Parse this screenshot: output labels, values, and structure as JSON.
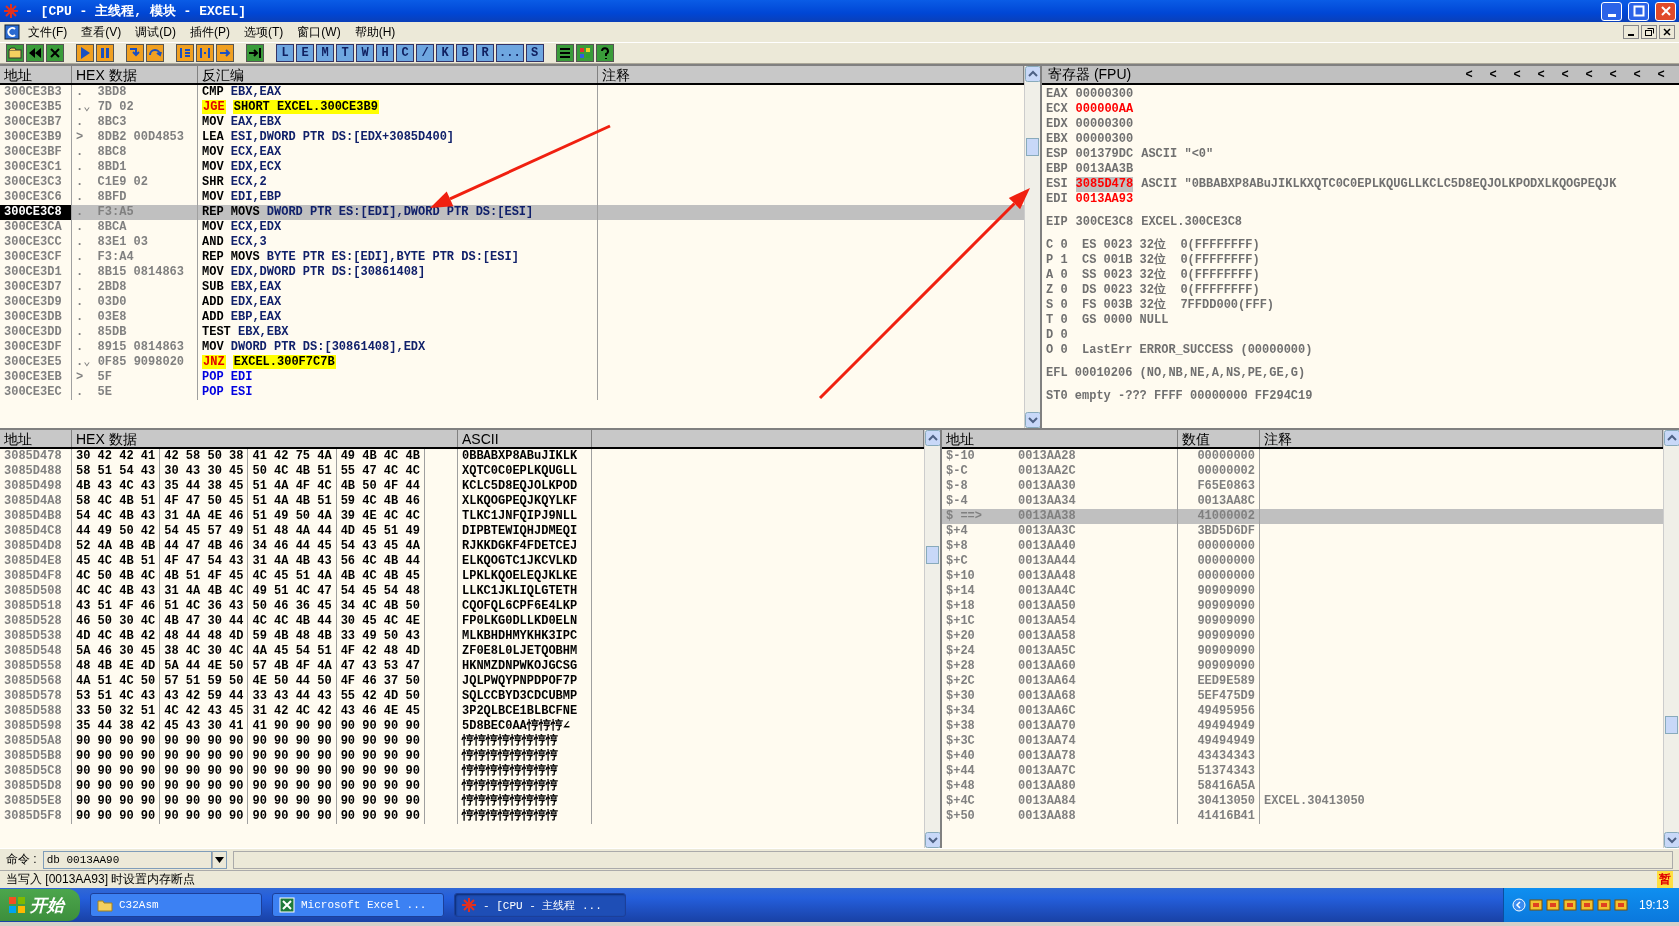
{
  "window": {
    "title": "- [CPU - 主线程, 模块 - EXCEL]"
  },
  "menu": {
    "items": [
      "文件(F)",
      "查看(V)",
      "调试(D)",
      "插件(P)",
      "选项(T)",
      "窗口(W)",
      "帮助(H)"
    ]
  },
  "toolbar": {
    "items": [
      {
        "kind": "icon"
      },
      {
        "kind": "icon"
      },
      {
        "kind": "icon"
      },
      {
        "kind": "sep"
      },
      {
        "kind": "icon"
      },
      {
        "kind": "icon"
      },
      {
        "kind": "sep"
      },
      {
        "kind": "icon"
      },
      {
        "kind": "icon"
      },
      {
        "kind": "sep"
      },
      {
        "kind": "icon"
      },
      {
        "kind": "icon"
      },
      {
        "kind": "icon"
      },
      {
        "kind": "sep"
      },
      {
        "kind": "icon"
      },
      {
        "kind": "sep"
      },
      {
        "kind": "letter",
        "label": "L"
      },
      {
        "kind": "letter",
        "label": "E"
      },
      {
        "kind": "letter",
        "label": "M"
      },
      {
        "kind": "letter",
        "label": "T"
      },
      {
        "kind": "letter",
        "label": "W"
      },
      {
        "kind": "letter",
        "label": "H"
      },
      {
        "kind": "letter",
        "label": "C"
      },
      {
        "kind": "letter",
        "label": "/"
      },
      {
        "kind": "letter",
        "label": "K"
      },
      {
        "kind": "letter",
        "label": "B"
      },
      {
        "kind": "letter",
        "label": "R"
      },
      {
        "kind": "letter",
        "label": "..."
      },
      {
        "kind": "letter",
        "label": "S"
      },
      {
        "kind": "sep"
      },
      {
        "kind": "icon"
      },
      {
        "kind": "icon"
      },
      {
        "kind": "icon"
      }
    ]
  },
  "disassembly": {
    "columns": [
      "地址",
      "HEX 数据",
      "反汇编",
      "注释"
    ],
    "rows": [
      {
        "address": "300CE3B3",
        "mark": ".",
        "hex": "3BD8",
        "kind": "plain",
        "mnemonic": "CMP",
        "operands": "EBX,EAX",
        "selected": false
      },
      {
        "address": "300CE3B5",
        "mark": ".⌄",
        "hex": "7D 02",
        "kind": "jump",
        "mnemonic": "JGE",
        "operands": "SHORT EXCEL.300CE3B9",
        "selected": false
      },
      {
        "address": "300CE3B7",
        "mark": ".",
        "hex": "8BC3",
        "kind": "plain",
        "mnemonic": "MOV",
        "operands": "EAX,EBX",
        "selected": false
      },
      {
        "address": "300CE3B9",
        "mark": ">",
        "hex": "8DB2 00D4853",
        "kind": "plain",
        "mnemonic": "LEA",
        "operands": "ESI,DWORD PTR DS:[EDX+3085D400]",
        "selected": false
      },
      {
        "address": "300CE3BF",
        "mark": ".",
        "hex": "8BC8",
        "kind": "plain",
        "mnemonic": "MOV",
        "operands": "ECX,EAX",
        "selected": false
      },
      {
        "address": "300CE3C1",
        "mark": ".",
        "hex": "8BD1",
        "kind": "plain",
        "mnemonic": "MOV",
        "operands": "EDX,ECX",
        "selected": false
      },
      {
        "address": "300CE3C3",
        "mark": ".",
        "hex": "C1E9 02",
        "kind": "plain",
        "mnemonic": "SHR",
        "operands": "ECX,2",
        "selected": false
      },
      {
        "address": "300CE3C6",
        "mark": ".",
        "hex": "8BFD",
        "kind": "plain",
        "mnemonic": "MOV",
        "operands": "EDI,EBP",
        "selected": false
      },
      {
        "address": "300CE3C8",
        "mark": ".",
        "hex": "F3:A5",
        "kind": "plain",
        "mnemonic": "REP MOVS",
        "operands": "DWORD PTR ES:[EDI],DWORD PTR DS:[ESI]",
        "selected": true
      },
      {
        "address": "300CE3CA",
        "mark": ".",
        "hex": "8BCA",
        "kind": "plain",
        "mnemonic": "MOV",
        "operands": "ECX,EDX",
        "selected": false
      },
      {
        "address": "300CE3CC",
        "mark": ".",
        "hex": "83E1 03",
        "kind": "plain",
        "mnemonic": "AND",
        "operands": "ECX,3",
        "selected": false
      },
      {
        "address": "300CE3CF",
        "mark": ".",
        "hex": "F3:A4",
        "kind": "plain",
        "mnemonic": "REP MOVS",
        "operands": "BYTE PTR ES:[EDI],BYTE PTR DS:[ESI]",
        "selected": false
      },
      {
        "address": "300CE3D1",
        "mark": ".",
        "hex": "8B15 0814863",
        "kind": "plain",
        "mnemonic": "MOV",
        "operands": "EDX,DWORD PTR DS:[30861408]",
        "selected": false
      },
      {
        "address": "300CE3D7",
        "mark": ".",
        "hex": "2BD8",
        "kind": "plain",
        "mnemonic": "SUB",
        "operands": "EBX,EAX",
        "selected": false
      },
      {
        "address": "300CE3D9",
        "mark": ".",
        "hex": "03D0",
        "kind": "plain",
        "mnemonic": "ADD",
        "operands": "EDX,EAX",
        "selected": false
      },
      {
        "address": "300CE3DB",
        "mark": ".",
        "hex": "03E8",
        "kind": "plain",
        "mnemonic": "ADD",
        "operands": "EBP,EAX",
        "selected": false
      },
      {
        "address": "300CE3DD",
        "mark": ".",
        "hex": "85DB",
        "kind": "plain",
        "mnemonic": "TEST",
        "operands": "EBX,EBX",
        "selected": false
      },
      {
        "address": "300CE3DF",
        "mark": ".",
        "hex": "8915 0814863",
        "kind": "plain",
        "mnemonic": "MOV",
        "operands": "DWORD PTR DS:[30861408],EDX",
        "selected": false
      },
      {
        "address": "300CE3E5",
        "mark": ".⌄",
        "hex": "0F85 9098020",
        "kind": "jump",
        "mnemonic": "JNZ",
        "operands": "EXCEL.300F7C7B",
        "selected": false
      },
      {
        "address": "300CE3EB",
        "mark": ">",
        "hex": "5F",
        "kind": "stack",
        "mnemonic": "POP",
        "operands": "EDI",
        "selected": false
      },
      {
        "address": "300CE3EC",
        "mark": ".",
        "hex": "5E",
        "kind": "stack",
        "mnemonic": "POP",
        "operands": "ESI",
        "selected": false
      }
    ]
  },
  "registers": {
    "title": "寄存器 (FPU)",
    "arrows": [
      "<",
      "<",
      "<",
      "<",
      "<",
      "<",
      "<",
      "<",
      "<"
    ],
    "groups": [
      [
        {
          "kind": "reg",
          "name": "EAX",
          "value": "00000300",
          "changed": false,
          "selected": false
        },
        {
          "kind": "reg",
          "name": "ECX",
          "value": "000000AA",
          "changed": true,
          "selected": false
        },
        {
          "kind": "reg",
          "name": "EDX",
          "value": "00000300",
          "changed": false,
          "selected": false
        },
        {
          "kind": "reg",
          "name": "EBX",
          "value": "00000300",
          "changed": false,
          "selected": false
        },
        {
          "kind": "reg",
          "name": "ESP",
          "value": "001379DC",
          "changed": false,
          "selected": false,
          "extra": "ASCII \"<0\""
        },
        {
          "kind": "reg",
          "name": "EBP",
          "value": "0013AA3B",
          "changed": false,
          "selected": false
        },
        {
          "kind": "reg",
          "name": "ESI",
          "value": "3085D478",
          "changed": true,
          "selected": true,
          "extra": "ASCII \"0BBABXP8ABuJIKLKXQTC0C0EPLKQUGLLKCLC5D8EQJOLKPODXLKQOGPEQJK"
        },
        {
          "kind": "reg",
          "name": "EDI",
          "value": "0013AA93",
          "changed": true,
          "selected": false
        }
      ],
      [
        {
          "kind": "reg",
          "name": "EIP",
          "value": "300CE3C8",
          "changed": false,
          "selected": false,
          "extra": "EXCEL.300CE3C8"
        }
      ],
      [
        {
          "kind": "line",
          "text": "C 0  ES 0023 32位  0(FFFFFFFF)"
        },
        {
          "kind": "line",
          "text": "P 1  CS 001B 32位  0(FFFFFFFF)"
        },
        {
          "kind": "line",
          "text": "A 0  SS 0023 32位  0(FFFFFFFF)"
        },
        {
          "kind": "line",
          "text": "Z 0  DS 0023 32位  0(FFFFFFFF)"
        },
        {
          "kind": "line",
          "text": "S 0  FS 003B 32位  7FFDD000(FFF)"
        },
        {
          "kind": "line",
          "text": "T 0  GS 0000 NULL"
        },
        {
          "kind": "line",
          "text": "D 0"
        },
        {
          "kind": "line",
          "text": "O 0  LastErr ERROR_SUCCESS (00000000)"
        }
      ],
      [
        {
          "kind": "line",
          "text": "EFL 00010206 (NO,NB,NE,A,NS,PE,GE,G)"
        }
      ],
      [
        {
          "kind": "line",
          "text": "ST0 empty -??? FFFF 00000000 FF294C19"
        }
      ]
    ]
  },
  "dump": {
    "columns": [
      "地址",
      "HEX 数据",
      "ASCII"
    ],
    "rows": [
      {
        "address": "3085D478",
        "groups": [
          "30 42 42 41",
          "42 58 50 38",
          "41 42 75 4A",
          "49 4B 4C 4B"
        ],
        "ascii": "0BBABXP8ABuJIKLK"
      },
      {
        "address": "3085D488",
        "groups": [
          "58 51 54 43",
          "30 43 30 45",
          "50 4C 4B 51",
          "55 47 4C 4C"
        ],
        "ascii": "XQTC0C0EPLKQUGLL"
      },
      {
        "address": "3085D498",
        "groups": [
          "4B 43 4C 43",
          "35 44 38 45",
          "51 4A 4F 4C",
          "4B 50 4F 44"
        ],
        "ascii": "KCLC5D8EQJOLKPOD"
      },
      {
        "address": "3085D4A8",
        "groups": [
          "58 4C 4B 51",
          "4F 47 50 45",
          "51 4A 4B 51",
          "59 4C 4B 46"
        ],
        "ascii": "XLKQOGPEQJKQYLKF"
      },
      {
        "address": "3085D4B8",
        "groups": [
          "54 4C 4B 43",
          "31 4A 4E 46",
          "51 49 50 4A",
          "39 4E 4C 4C"
        ],
        "ascii": "TLKC1JNFQIPJ9NLL"
      },
      {
        "address": "3085D4C8",
        "groups": [
          "44 49 50 42",
          "54 45 57 49",
          "51 48 4A 44",
          "4D 45 51 49"
        ],
        "ascii": "DIPBTEWIQHJDMEQI"
      },
      {
        "address": "3085D4D8",
        "groups": [
          "52 4A 4B 4B",
          "44 47 4B 46",
          "34 46 44 45",
          "54 43 45 4A"
        ],
        "ascii": "RJKKDGKF4FDETCEJ"
      },
      {
        "address": "3085D4E8",
        "groups": [
          "45 4C 4B 51",
          "4F 47 54 43",
          "31 4A 4B 43",
          "56 4C 4B 44"
        ],
        "ascii": "ELKQOGTC1JKCVLKD"
      },
      {
        "address": "3085D4F8",
        "groups": [
          "4C 50 4B 4C",
          "4B 51 4F 45",
          "4C 45 51 4A",
          "4B 4C 4B 45"
        ],
        "ascii": "LPKLKQOELEQJKLKE"
      },
      {
        "address": "3085D508",
        "groups": [
          "4C 4C 4B 43",
          "31 4A 4B 4C",
          "49 51 4C 47",
          "54 45 54 48"
        ],
        "ascii": "LLKC1JKLIQLGTETH"
      },
      {
        "address": "3085D518",
        "groups": [
          "43 51 4F 46",
          "51 4C 36 43",
          "50 46 36 45",
          "34 4C 4B 50"
        ],
        "ascii": "CQOFQL6CPF6E4LKP"
      },
      {
        "address": "3085D528",
        "groups": [
          "46 50 30 4C",
          "4B 47 30 44",
          "4C 4C 4B 44",
          "30 45 4C 4E"
        ],
        "ascii": "FP0LKG0DLLKD0ELN"
      },
      {
        "address": "3085D538",
        "groups": [
          "4D 4C 4B 42",
          "48 44 48 4D",
          "59 4B 48 4B",
          "33 49 50 43"
        ],
        "ascii": "MLKBHDHMYKHK3IPC"
      },
      {
        "address": "3085D548",
        "groups": [
          "5A 46 30 45",
          "38 4C 30 4C",
          "4A 45 54 51",
          "4F 42 48 4D"
        ],
        "ascii": "ZF0E8L0LJETQOBHM"
      },
      {
        "address": "3085D558",
        "groups": [
          "48 4B 4E 4D",
          "5A 44 4E 50",
          "57 4B 4F 4A",
          "47 43 53 47"
        ],
        "ascii": "HKNMZDNPWKOJGCSG"
      },
      {
        "address": "3085D568",
        "groups": [
          "4A 51 4C 50",
          "57 51 59 50",
          "4E 50 44 50",
          "4F 46 37 50"
        ],
        "ascii": "JQLPWQYPNPDPOF7P"
      },
      {
        "address": "3085D578",
        "groups": [
          "53 51 4C 43",
          "43 42 59 44",
          "33 43 44 43",
          "55 42 4D 50"
        ],
        "ascii": "SQLCCBYD3CDCUBMP"
      },
      {
        "address": "3085D588",
        "groups": [
          "33 50 32 51",
          "4C 42 43 45",
          "31 42 4C 42",
          "43 46 4E 45"
        ],
        "ascii": "3P2QLBCE1BLBCFNE"
      },
      {
        "address": "3085D598",
        "groups": [
          "35 44 38 42",
          "45 43 30 41",
          "41 90 90 90",
          "90 90 90 90"
        ],
        "ascii": "5D8BEC0AA悙悙悙∠"
      },
      {
        "address": "3085D5A8",
        "groups": [
          "90 90 90 90",
          "90 90 90 90",
          "90 90 90 90",
          "90 90 90 90"
        ],
        "ascii": "悙悙悙悙悙悙悙悙"
      },
      {
        "address": "3085D5B8",
        "groups": [
          "90 90 90 90",
          "90 90 90 90",
          "90 90 90 90",
          "90 90 90 90"
        ],
        "ascii": "悙悙悙悙悙悙悙悙"
      },
      {
        "address": "3085D5C8",
        "groups": [
          "90 90 90 90",
          "90 90 90 90",
          "90 90 90 90",
          "90 90 90 90"
        ],
        "ascii": "悙悙悙悙悙悙悙悙"
      },
      {
        "address": "3085D5D8",
        "groups": [
          "90 90 90 90",
          "90 90 90 90",
          "90 90 90 90",
          "90 90 90 90"
        ],
        "ascii": "悙悙悙悙悙悙悙悙"
      },
      {
        "address": "3085D5E8",
        "groups": [
          "90 90 90 90",
          "90 90 90 90",
          "90 90 90 90",
          "90 90 90 90"
        ],
        "ascii": "悙悙悙悙悙悙悙悙"
      },
      {
        "address": "3085D5F8",
        "groups": [
          "90 90 90 90",
          "90 90 90 90",
          "90 90 90 90",
          "90 90 90 90"
        ],
        "ascii": "悙悙悙悙悙悙悙悙"
      }
    ]
  },
  "stack": {
    "columns": [
      "地址",
      "数值",
      "注释"
    ],
    "rows": [
      {
        "offset": "$-10",
        "address": "0013AA28",
        "value": "00000000",
        "selected": false
      },
      {
        "offset": "$-C",
        "address": "0013AA2C",
        "value": "00000002",
        "selected": false
      },
      {
        "offset": "$-8",
        "address": "0013AA30",
        "value": "F65E0863",
        "selected": false
      },
      {
        "offset": "$-4",
        "address": "0013AA34",
        "value": "0013AA8C",
        "selected": false
      },
      {
        "offset": "$ ==>",
        "address": "0013AA38",
        "value": "41000002",
        "selected": true
      },
      {
        "offset": "$+4",
        "address": "0013AA3C",
        "value": "3BD5D6DF",
        "selected": false
      },
      {
        "offset": "$+8",
        "address": "0013AA40",
        "value": "00000000",
        "selected": false
      },
      {
        "offset": "$+C",
        "address": "0013AA44",
        "value": "00000000",
        "selected": false
      },
      {
        "offset": "$+10",
        "address": "0013AA48",
        "value": "00000000",
        "selected": false
      },
      {
        "offset": "$+14",
        "address": "0013AA4C",
        "value": "90909090",
        "selected": false
      },
      {
        "offset": "$+18",
        "address": "0013AA50",
        "value": "90909090",
        "selected": false
      },
      {
        "offset": "$+1C",
        "address": "0013AA54",
        "value": "90909090",
        "selected": false
      },
      {
        "offset": "$+20",
        "address": "0013AA58",
        "value": "90909090",
        "selected": false
      },
      {
        "offset": "$+24",
        "address": "0013AA5C",
        "value": "90909090",
        "selected": false
      },
      {
        "offset": "$+28",
        "address": "0013AA60",
        "value": "90909090",
        "selected": false
      },
      {
        "offset": "$+2C",
        "address": "0013AA64",
        "value": "EED9E589",
        "selected": false
      },
      {
        "offset": "$+30",
        "address": "0013AA68",
        "value": "5EF475D9",
        "selected": false
      },
      {
        "offset": "$+34",
        "address": "0013AA6C",
        "value": "49495956",
        "selected": false
      },
      {
        "offset": "$+38",
        "address": "0013AA70",
        "value": "49494949",
        "selected": false
      },
      {
        "offset": "$+3C",
        "address": "0013AA74",
        "value": "49494949",
        "selected": false
      },
      {
        "offset": "$+40",
        "address": "0013AA78",
        "value": "43434343",
        "selected": false
      },
      {
        "offset": "$+44",
        "address": "0013AA7C",
        "value": "51374343",
        "selected": false
      },
      {
        "offset": "$+48",
        "address": "0013AA80",
        "value": "58416A5A",
        "selected": false
      },
      {
        "offset": "$+4C",
        "address": "0013AA84",
        "value": "30413050",
        "selected": false,
        "comment": "EXCEL.30413050"
      },
      {
        "offset": "$+50",
        "address": "0013AA88",
        "value": "41416B41",
        "selected": false
      }
    ]
  },
  "command": {
    "label": "命令 :",
    "value": "db 0013AA90"
  },
  "status_bar": {
    "text": "当写入 [0013AA93] 时设置内存断点",
    "indicator": "暂"
  },
  "taskbar": {
    "start": "开始",
    "items": [
      {
        "kind": "folder",
        "label": "C32Asm",
        "selected": false
      },
      {
        "kind": "excel",
        "label": "Microsoft Excel ...",
        "selected": false
      },
      {
        "kind": "debugger",
        "label": "- [CPU - 主线程 ...",
        "selected": true
      }
    ],
    "clock": "19:13"
  }
}
